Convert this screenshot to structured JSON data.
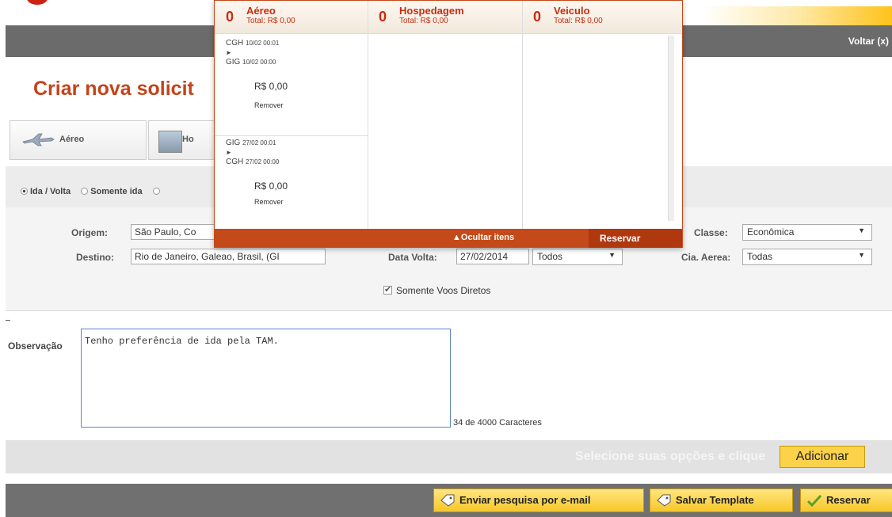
{
  "header": {
    "voltar": "Voltar (x)"
  },
  "page": {
    "title": "Criar nova solicit"
  },
  "tabs": [
    {
      "label": "Aéreo"
    },
    {
      "label": "Ho"
    }
  ],
  "trip_type": {
    "round_trip": "Ida / Volta",
    "one_way": "Somente ida"
  },
  "form": {
    "origem_label": "Origem:",
    "origem_value": "São Paulo,  Co",
    "destino_label": "Destino:",
    "destino_value": "Rio de Janeiro,  Galeao,  Brasil,  (GI",
    "data_volta_label": "Data Volta:",
    "data_volta_value": "27/02/2014",
    "todos_value": "Todos",
    "classe_label": "Classe:",
    "classe_value": "Econômica",
    "cia_label": "Cia. Aerea:",
    "cia_value": "Todas",
    "direct_flights": "Somente Voos Diretos"
  },
  "observation": {
    "label": "Observação",
    "text": "Tenho preferência de ida pela TAM.",
    "counter": "34 de 4000  Caracteres"
  },
  "action_bar": {
    "hint": "Selecione suas opções e clique",
    "add_button": "Adicionar"
  },
  "footer": {
    "email_button": "Enviar pesquisa por e-mail",
    "template_button": "Salvar Template",
    "reserve_button": "Reservar"
  },
  "cart": {
    "columns": [
      {
        "count": "0",
        "title": "Aéreo",
        "total": "Total: R$ 0,00"
      },
      {
        "count": "0",
        "title": "Hospedagem",
        "total": "Total: R$ 0,00"
      },
      {
        "count": "0",
        "title": "Veiculo",
        "total": "Total: R$ 0,00"
      }
    ],
    "items": [
      {
        "from": "CGH",
        "from_date": "10/02 00:01",
        "arrow": "►",
        "to": "GIG",
        "to_date": "10/02 00:00",
        "price": "R$ 0,00",
        "remove": "Remover"
      },
      {
        "from": "GIG",
        "from_date": "27/02 00:01",
        "arrow": "►",
        "to": "CGH",
        "to_date": "27/02 00:00",
        "price": "R$ 0,00",
        "remove": "Remover"
      }
    ],
    "hide_items": "▲Ocultar itens",
    "reserve": "Reservar"
  }
}
